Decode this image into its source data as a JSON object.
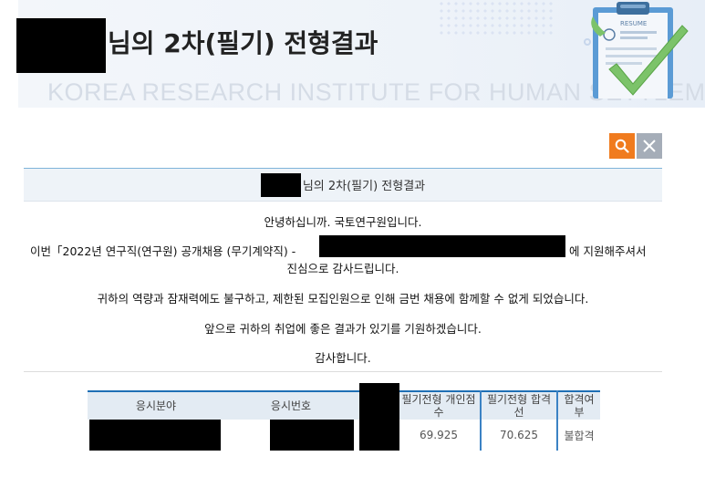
{
  "banner": {
    "title_suffix": "님의 2차(필기) 전형결과",
    "watermark": "KOREA RESEARCH INSTITUTE FOR HUMAN SETTLEMENTS",
    "resume_label": "RESUME"
  },
  "result": {
    "header_suffix": "님의 2차(필기) 전형결과",
    "greeting": "안녕하십니까. 국토연구원입니다.",
    "line2_prefix": "이번「2022년 연구직(연구원) 공개채용 (무기계약직) -",
    "line2_suffix": "에 지원해주셔서",
    "line3": "진심으로 감사드립니다.",
    "line4": "귀하의 역량과 잠재력에도 불구하고, 제한된 모집인원으로 인해 금번 채용에 함께할 수 없게 되었습니다.",
    "line5": "앞으로 귀하의 취업에 좋은 결과가 있기를 기원하겠습니다.",
    "closing": "감사합니다."
  },
  "table": {
    "headers": {
      "field": "응시분야",
      "number": "응시번호",
      "score_l1": "필기전형 개인점",
      "score_l2": "수",
      "cutoff_l1": "필기전형 합격",
      "cutoff_l2": "선",
      "pass_l1": "합격여",
      "pass_l2": "부"
    },
    "row": {
      "score": "69.925",
      "cutoff": "70.625",
      "pass": "불합격"
    }
  },
  "colors": {
    "accent_orange": "#f07b1e",
    "accent_blue": "#1f6fb5",
    "close_gray": "#a5adb8"
  }
}
